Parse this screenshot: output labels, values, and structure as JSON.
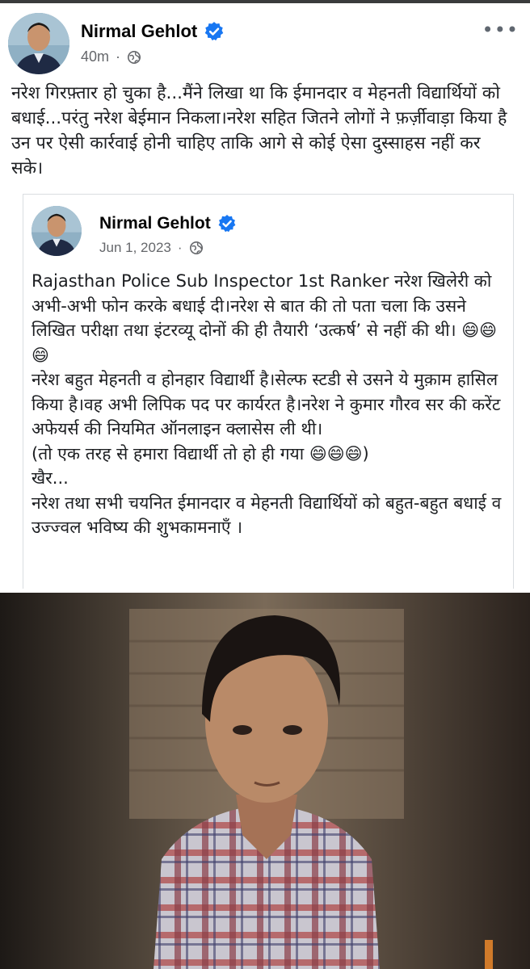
{
  "post": {
    "author": "Nirmal Gehlot",
    "time": "40m",
    "separator": "·",
    "more": "•••",
    "text": "नरेश गिरफ़्तार हो चुका है...मैंने लिखा था कि ईमानदार व मेहनती विद्यार्थियों को बधाई...परंतु नरेश बेईमान निकला।नरेश सहित जितने लोगों ने फ़र्ज़ीवाड़ा किया है उन पर ऐसी कार्रवाई होनी चाहिए ताकि आगे से कोई ऐसा दुस्साहस नहीं कर सके।"
  },
  "shared": {
    "author": "Nirmal Gehlot",
    "date": "Jun 1, 2023",
    "separator": "·",
    "p1": "Rajasthan Police Sub Inspector 1st Ranker नरेश खिलेरी को अभी-अभी फोन करके बधाई दी।नरेश से बात की तो पता चला कि उसने लिखित परीक्षा तथा इंटरव्यू दोनों की ही तैयारी ‘उत्कर्ष’ से नहीं की थी। 😄😄😄",
    "p2": "नरेश बहुत मेहनती व होनहार विद्यार्थी है।सेल्फ स्टडी से उसने ये मुक़ाम हासिल किया है।वह अभी लिपिक पद पर कार्यरत है।नरेश ने कुमार गौरव सर की करेंट अफेयर्स की नियमित ऑनलाइन क्लासेस ली थी।",
    "p3": "(तो एक तरह से हमारा विद्यार्थी तो हो ही गया 😄😄😄)",
    "p4": "खैर...",
    "p5": "नरेश तथा सभी चयनित ईमानदार व मेहनती विद्यार्थियों को बहुत-बहुत बधाई व उज्ज्वल भविष्य की शुभकामनाएँ ।"
  },
  "colors": {
    "verified": "#1877f2",
    "meta": "#65676b",
    "text": "#1c1e21"
  },
  "icons": [
    "verified-badge-icon",
    "globe-icon",
    "more-options-icon"
  ]
}
